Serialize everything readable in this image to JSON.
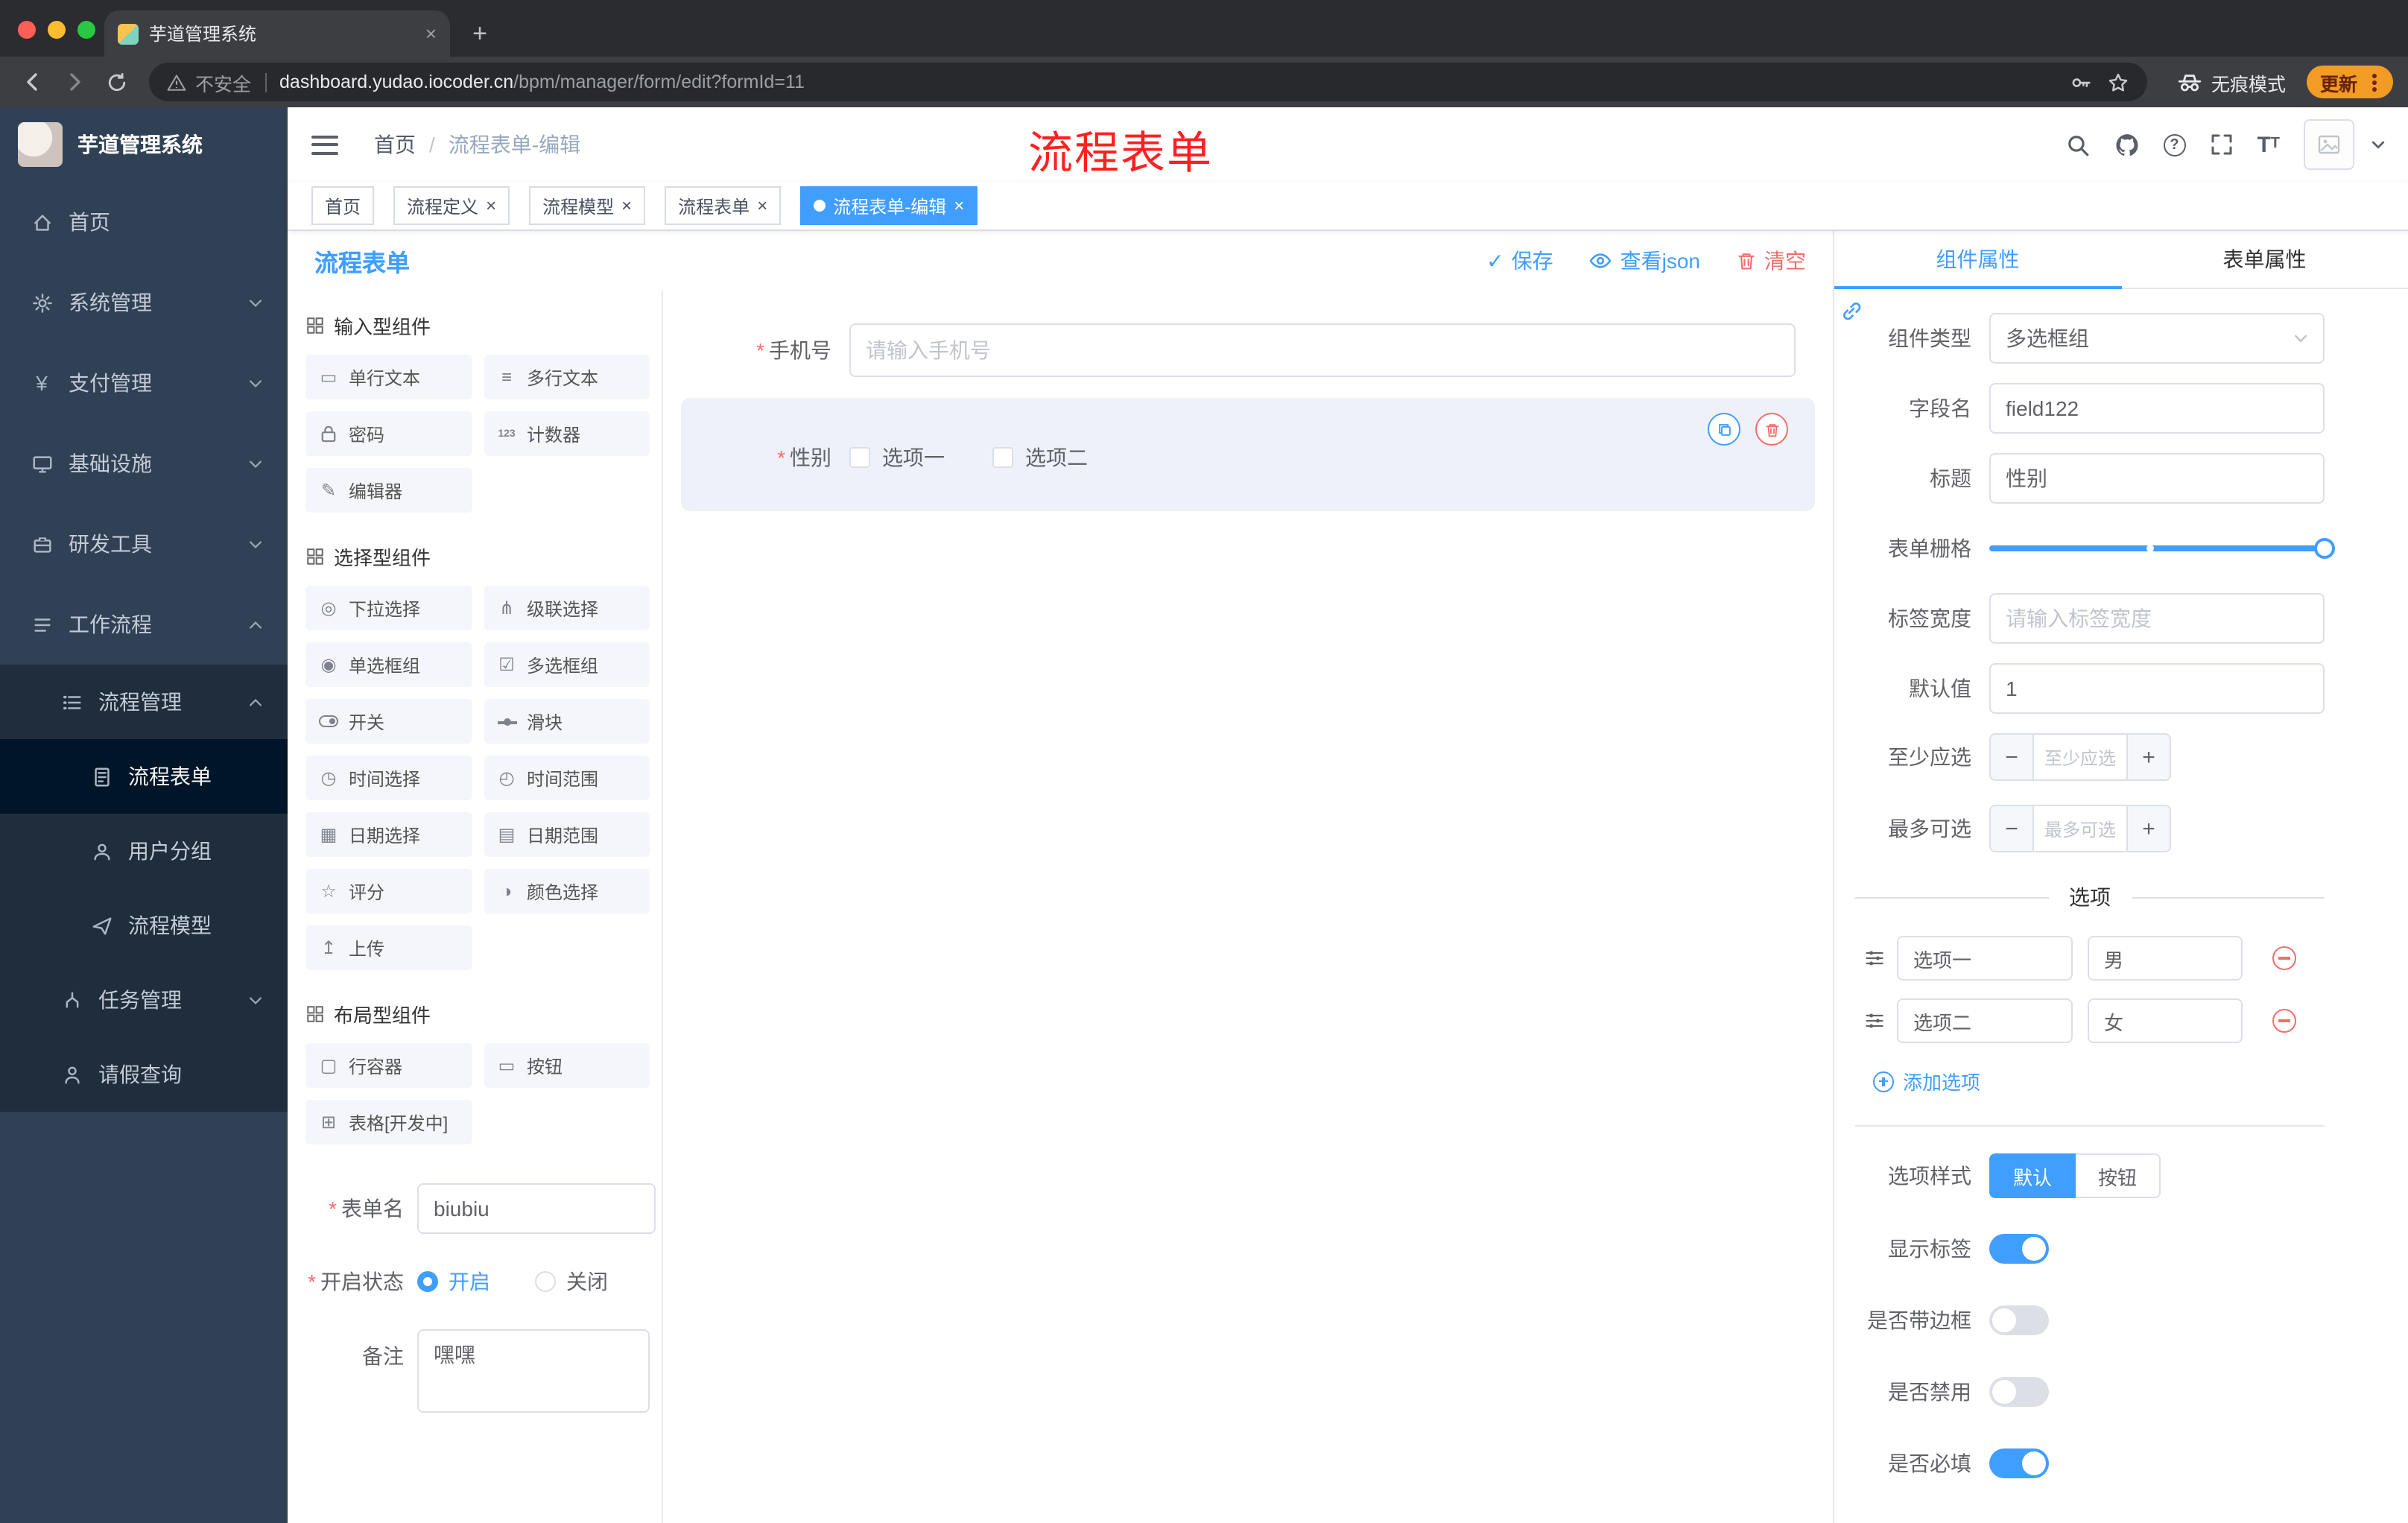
{
  "colors": {
    "primary": "#409eff",
    "danger": "#f56c6c",
    "annotation_red": "#ff2121",
    "sidebar_bg": "#304156",
    "submenu_bg": "#1f2d3d",
    "update_pill": "#f29b25"
  },
  "browser": {
    "tab_title": "芋道管理系统",
    "security_label": "不安全",
    "url_domain": "dashboard.yudao.iocoder.cn",
    "url_path": "/bpm/manager/form/edit?formId=11",
    "incognito_label": "无痕模式",
    "update_label": "更新"
  },
  "annotation": {
    "text": "流程表单"
  },
  "header": {
    "logo_title": "芋道管理系统",
    "breadcrumb": {
      "home": "首页",
      "current": "流程表单-编辑"
    }
  },
  "sidebar": {
    "items": [
      {
        "label": "首页",
        "icon": "home-icon"
      },
      {
        "label": "系统管理",
        "icon": "gear-icon"
      },
      {
        "label": "支付管理",
        "icon": "payment-yen-icon"
      },
      {
        "label": "基础设施",
        "icon": "infrastructure-icon"
      },
      {
        "label": "研发工具",
        "icon": "dev-tools-icon"
      },
      {
        "label": "工作流程",
        "icon": "workflow-icon"
      },
      {
        "label": "流程管理",
        "icon": "process-management-icon"
      },
      {
        "label": "流程表单",
        "icon": "process-form-icon"
      },
      {
        "label": "用户分组",
        "icon": "user-group-icon"
      },
      {
        "label": "流程模型",
        "icon": "process-model-icon"
      },
      {
        "label": "任务管理",
        "icon": "task-management-icon"
      },
      {
        "label": "请假查询",
        "icon": "leave-query-icon"
      }
    ]
  },
  "tags": {
    "items": [
      {
        "label": "首页"
      },
      {
        "label": "流程定义"
      },
      {
        "label": "流程模型"
      },
      {
        "label": "流程表单"
      },
      {
        "label": "流程表单-编辑"
      }
    ]
  },
  "designer": {
    "title": "流程表单",
    "actions": {
      "save": "保存",
      "view_json": "查看json",
      "clear": "清空"
    },
    "palette": {
      "sections": [
        {
          "title": "输入型组件",
          "items": [
            {
              "label": "单行文本",
              "icon": "single-line-text-icon"
            },
            {
              "label": "多行文本",
              "icon": "multi-line-text-icon"
            },
            {
              "label": "密码",
              "icon": "password-icon"
            },
            {
              "label": "计数器",
              "icon": "counter-icon"
            },
            {
              "label": "编辑器",
              "icon": "editor-icon"
            }
          ]
        },
        {
          "title": "选择型组件",
          "items": [
            {
              "label": "下拉选择",
              "icon": "select-icon"
            },
            {
              "label": "级联选择",
              "icon": "cascader-icon"
            },
            {
              "label": "单选框组",
              "icon": "radio-group-icon"
            },
            {
              "label": "多选框组",
              "icon": "checkbox-group-icon"
            },
            {
              "label": "开关",
              "icon": "switch-icon"
            },
            {
              "label": "滑块",
              "icon": "slider-icon"
            },
            {
              "label": "时间选择",
              "icon": "time-picker-icon"
            },
            {
              "label": "时间范围",
              "icon": "time-range-icon"
            },
            {
              "label": "日期选择",
              "icon": "date-picker-icon"
            },
            {
              "label": "日期范围",
              "icon": "date-range-icon"
            },
            {
              "label": "评分",
              "icon": "rate-icon"
            },
            {
              "label": "颜色选择",
              "icon": "color-picker-icon"
            },
            {
              "label": "上传",
              "icon": "upload-icon"
            }
          ]
        },
        {
          "title": "布局型组件",
          "items": [
            {
              "label": "行容器",
              "icon": "row-container-icon"
            },
            {
              "label": "按钮",
              "icon": "button-icon"
            },
            {
              "label": "表格[开发中]",
              "icon": "table-icon"
            }
          ]
        }
      ]
    },
    "left_form": {
      "form_name_label": "表单名",
      "form_name_value": "biubiu",
      "status_label": "开启状态",
      "status_on": "开启",
      "status_off": "关闭",
      "remark_label": "备注",
      "remark_value": "嘿嘿"
    },
    "canvas": {
      "phone_label": "手机号",
      "phone_placeholder": "请输入手机号",
      "gender_label": "性别",
      "gender_option1": "选项一",
      "gender_option2": "选项二"
    }
  },
  "props": {
    "tabs": {
      "component": "组件属性",
      "form": "表单属性"
    },
    "component_type_label": "组件类型",
    "component_type_value": "多选框组",
    "field_name_label": "字段名",
    "field_name_value": "field122",
    "title_label": "标题",
    "title_value": "性别",
    "grid_label": "表单栅格",
    "label_width_label": "标签宽度",
    "label_width_placeholder": "请输入标签宽度",
    "default_label": "默认值",
    "default_value": "1",
    "min_label": "至少应选",
    "min_placeholder": "至少应选",
    "max_label": "最多可选",
    "max_placeholder": "最多可选",
    "options_divider": "选项",
    "options": [
      {
        "label": "选项一",
        "value": "男"
      },
      {
        "label": "选项二",
        "value": "女"
      }
    ],
    "add_option": "添加选项",
    "option_style_label": "选项样式",
    "option_style_default": "默认",
    "option_style_button": "按钮",
    "switch_show_label": "显示标签",
    "switch_border": "是否带边框",
    "switch_disabled": "是否禁用",
    "switch_required": "是否必填"
  }
}
